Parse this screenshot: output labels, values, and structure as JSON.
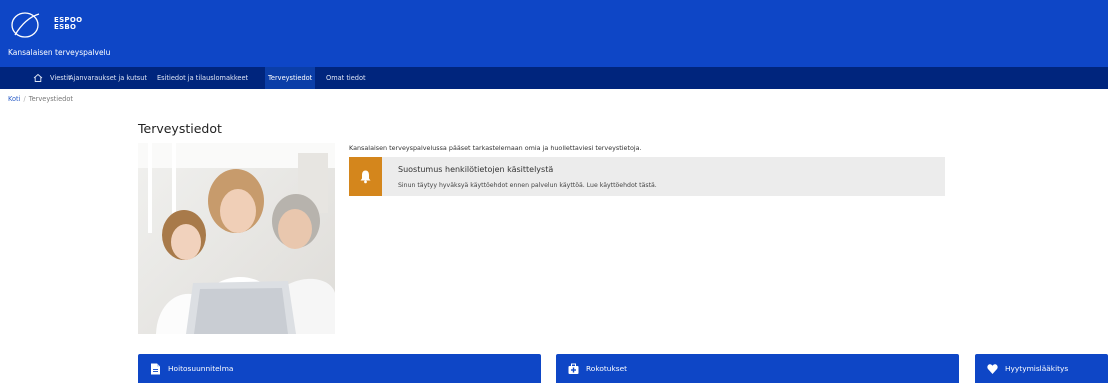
{
  "header": {
    "logo_line1": "ESPOO",
    "logo_line2": "ESBO",
    "service_name": "Kansalaisen terveyspalvelu"
  },
  "nav": {
    "home_icon": "home-icon",
    "items": [
      {
        "label": "Viestit"
      },
      {
        "label": "Ajanvaraukset ja kutsut"
      },
      {
        "label": "Esitiedot ja tilauslomakkeet"
      },
      {
        "label": "Terveystiedot",
        "active": true
      },
      {
        "label": "Omat tiedot"
      }
    ]
  },
  "breadcrumb": {
    "home": "Koti",
    "separator": "/",
    "current": "Terveystiedot"
  },
  "page": {
    "title": "Terveystiedot",
    "intro": "Kansalaisen terveyspalvelussa pääset tarkastelemaan omia ja huollettaviesi terveystietoja."
  },
  "notice": {
    "icon": "bell-icon",
    "title": "Suostumus henkilötietojen käsittelystä",
    "text": "Sinun täytyy hyväksyä käyttöehdot ennen palvelun käyttöä. Lue käyttöehdot tästä."
  },
  "cards": [
    {
      "title": "Hoitosuunnitelma",
      "icon": "document-icon"
    },
    {
      "title": "Rokotukset",
      "icon": "medical-kit-icon"
    },
    {
      "title": "Hyytymislääkitys",
      "icon": "heart-icon"
    }
  ],
  "colors": {
    "header": "#0e46c6",
    "nav": "#00257d",
    "notice_accent": "#d4861c"
  }
}
